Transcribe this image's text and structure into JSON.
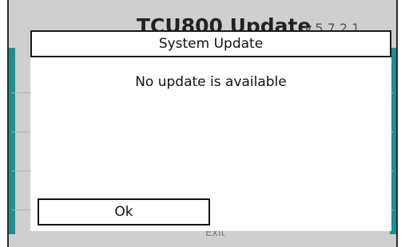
{
  "background": {
    "title": "TCU800 Update",
    "version": "v.5.7.2.1",
    "exit_label": "Exit"
  },
  "dialog": {
    "title": "System Update",
    "message": "No update is available",
    "ok_label": "Ok"
  },
  "colors": {
    "accent": "#1f8f8f",
    "dialog_bg": "#ffffff",
    "backdrop": "#cfcfcf"
  }
}
